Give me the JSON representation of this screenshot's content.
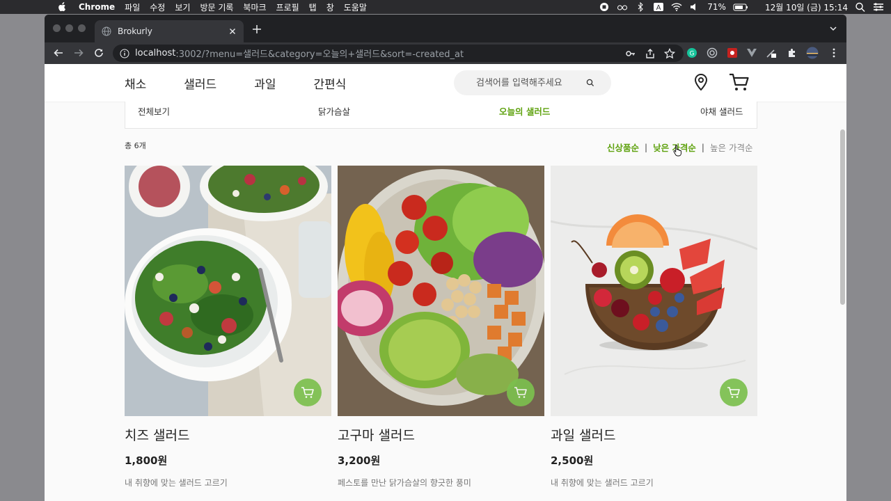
{
  "menubar": {
    "app": "Chrome",
    "items": [
      "파일",
      "수정",
      "보기",
      "방문 기록",
      "북마크",
      "프로필",
      "탭",
      "창",
      "도움말"
    ],
    "battery": "71%",
    "datetime": "12월 10일 (금)  15:14"
  },
  "browser": {
    "tab_title": "Brokurly",
    "url_host": "localhost",
    "url_path": ":3002/?menu=샐러드&category=오늘의+샐러드&sort=-created_at"
  },
  "header": {
    "nav": [
      "채소",
      "샐러드",
      "과일",
      "간편식"
    ],
    "search_placeholder": "검색어를 입력해주세요"
  },
  "subnav": {
    "items": [
      "전체보기",
      "닭가슴살",
      "오늘의 샐러드",
      "야채 샐러드"
    ],
    "active_index": 2
  },
  "listing": {
    "count": "총 6개",
    "sort": [
      "신상품순",
      "낮은 가격순",
      "높은 가격순"
    ]
  },
  "products": [
    {
      "name": "치즈 샐러드",
      "price": "1,800원",
      "desc": "내 취향에 맞는 샐러드 고르기"
    },
    {
      "name": "고구마 샐러드",
      "price": "3,200원",
      "desc": "페스토를 만난 닭가슴살의 향긋한 풍미"
    },
    {
      "name": "과일 샐러드",
      "price": "2,500원",
      "desc": "내 취향에 맞는 샐러드 고르기"
    }
  ],
  "colors": {
    "accent": "#5fa20f",
    "cart_button": "#7cc04e"
  },
  "icons": [
    "apple-icon",
    "globe-icon",
    "close-icon",
    "plus-icon",
    "back-icon",
    "forward-icon",
    "reload-icon",
    "info-icon",
    "key-icon",
    "share-icon",
    "star-icon",
    "search-icon",
    "location-pin-icon",
    "cart-icon"
  ]
}
